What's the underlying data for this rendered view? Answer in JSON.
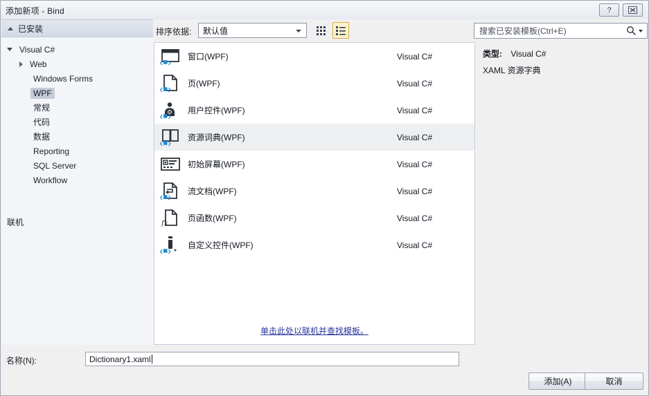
{
  "window": {
    "title": "添加新项 - Bind",
    "help_icon": "question-mark-icon",
    "close_icon": "close-icon"
  },
  "sidebar": {
    "header": {
      "label": "已安装",
      "expander_icon": "triangle-down-icon"
    },
    "items": [
      {
        "label": "Visual C#",
        "level": 0,
        "expander": "open",
        "selected": false
      },
      {
        "label": "Web",
        "level": 1,
        "expander": "closed",
        "selected": false
      },
      {
        "label": "Windows Forms",
        "level": 1,
        "expander": "none",
        "selected": false
      },
      {
        "label": "WPF",
        "level": 1,
        "expander": "none",
        "selected": true
      },
      {
        "label": "常规",
        "level": 1,
        "expander": "none",
        "selected": false
      },
      {
        "label": "代码",
        "level": 1,
        "expander": "none",
        "selected": false
      },
      {
        "label": "数据",
        "level": 1,
        "expander": "none",
        "selected": false
      },
      {
        "label": "Reporting",
        "level": 1,
        "expander": "none",
        "selected": false
      },
      {
        "label": "SQL Server",
        "level": 1,
        "expander": "none",
        "selected": false
      },
      {
        "label": "Workflow",
        "level": 1,
        "expander": "none",
        "selected": false
      }
    ],
    "online": {
      "label": "联机",
      "expander_icon": "triangle-right-icon"
    }
  },
  "toolbar": {
    "sort_label": "排序依据:",
    "sort_value": "默认值",
    "view_grid_icon": "grid-view-icon",
    "view_list_icon": "list-view-icon",
    "view_list_active": true,
    "highlight_color": "#e0a93b"
  },
  "search": {
    "placeholder": "搜索已安装模板(Ctrl+E)",
    "icon": "search-icon",
    "dropdown_icon": "chevron-down-icon"
  },
  "templates": {
    "language_column": "Visual C#",
    "items": [
      {
        "name": "窗口(WPF)",
        "language": "Visual C#",
        "icon": "window-template-icon",
        "selected": false
      },
      {
        "name": "页(WPF)",
        "language": "Visual C#",
        "icon": "page-template-icon",
        "selected": false
      },
      {
        "name": "用户控件(WPF)",
        "language": "Visual C#",
        "icon": "user-control-template-icon",
        "selected": false
      },
      {
        "name": "资源词典(WPF)",
        "language": "Visual C#",
        "icon": "resource-dictionary-template-icon",
        "selected": true
      },
      {
        "name": "初始屏幕(WPF)",
        "language": "Visual C#",
        "icon": "splash-screen-template-icon",
        "selected": false
      },
      {
        "name": "流文档(WPF)",
        "language": "Visual C#",
        "icon": "flow-document-template-icon",
        "selected": false
      },
      {
        "name": "页函数(WPF)",
        "language": "Visual C#",
        "icon": "page-function-template-icon",
        "selected": false
      },
      {
        "name": "自定义控件(WPF)",
        "language": "Visual C#",
        "icon": "custom-control-template-icon",
        "selected": false
      }
    ],
    "online_link": "单击此处以联机并查找模板。"
  },
  "details": {
    "type_label": "类型:",
    "type_value": "Visual C#",
    "description": "XAML 资源字典"
  },
  "footer": {
    "name_label": "名称(N):",
    "name_value": "Dictionary1.xaml",
    "add_label": "添加(A)",
    "cancel_label": "取消"
  }
}
